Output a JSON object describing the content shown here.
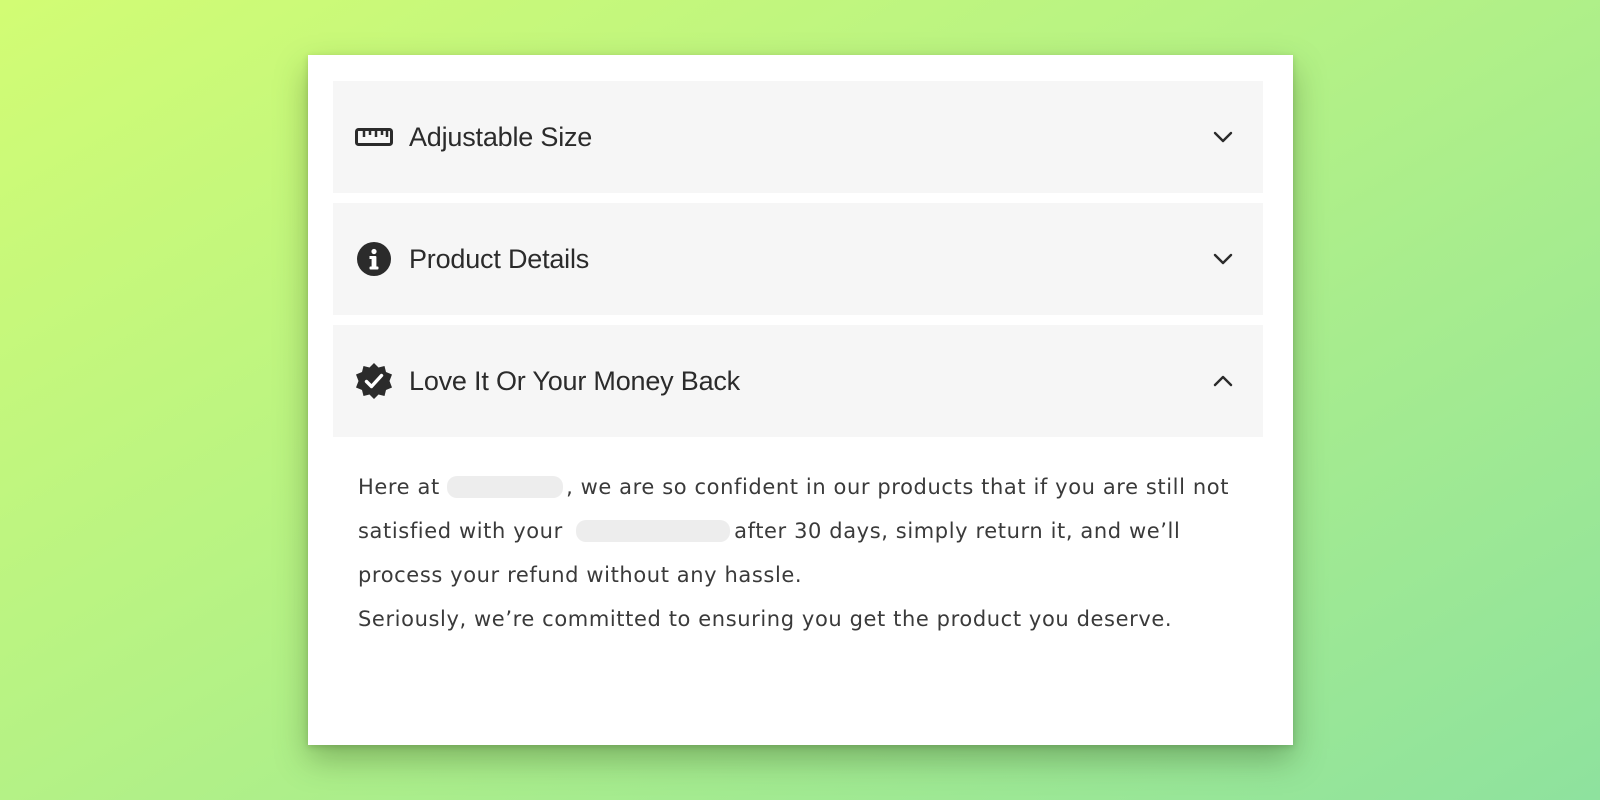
{
  "accordion": {
    "items": [
      {
        "title": "Adjustable Size",
        "icon": "ruler-icon",
        "expanded": false
      },
      {
        "title": "Product Details",
        "icon": "info-icon",
        "expanded": false
      },
      {
        "title": "Love It Or Your Money Back",
        "icon": "verified-badge-icon",
        "expanded": true
      }
    ],
    "panel": {
      "line1_before": "Here at",
      "line1_after": ", we are so confident in our products that if you are still not satisfied with your",
      "line1_end": "after 30 days, simply return it, and we’ll process your refund without any hassle.",
      "line2": "Seriously, we’re committed to ensuring you get the product you deserve."
    }
  },
  "colors": {
    "header_bg": "#f6f6f6",
    "text": "#2b2b2b"
  }
}
